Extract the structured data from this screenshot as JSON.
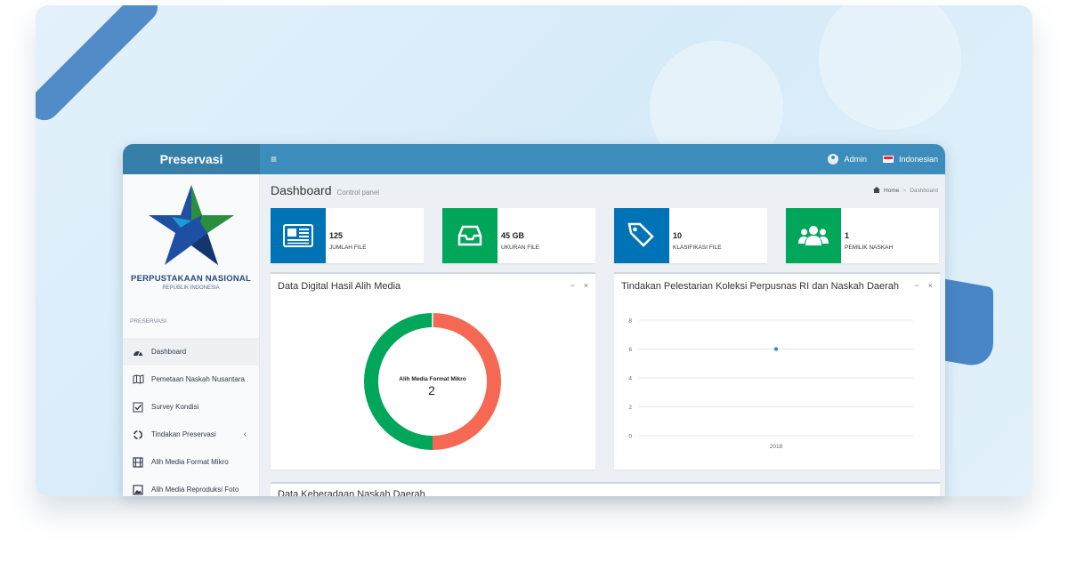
{
  "app": {
    "brand": "Preservasi",
    "menu_toggle": "≡",
    "user": "Admin",
    "language": "Indonesian"
  },
  "logo": {
    "title": "PERPUSTAKAAN NASIONAL",
    "subtitle": "REPUBLIK INDONESIA"
  },
  "sidebar": {
    "section": "PRESERVASI",
    "items": [
      {
        "label": "Dashboard",
        "icon": "dashboard-gauge-icon"
      },
      {
        "label": "Pemetaan Naskah Nusantara",
        "icon": "map-icon"
      },
      {
        "label": "Survey Kondisi",
        "icon": "checkbox-icon"
      },
      {
        "label": "Tindakan Preservasi",
        "icon": "recycle-icon"
      },
      {
        "label": "Alih Media Format Mikro",
        "icon": "film-icon"
      },
      {
        "label": "Alih Media Reproduksi Foto",
        "icon": "image-icon"
      }
    ]
  },
  "header": {
    "title": "Dashboard",
    "subtitle": "Control panel"
  },
  "breadcrumb": {
    "home": "Home",
    "separator": ">",
    "current": "Dashboard"
  },
  "stats": [
    {
      "value": "125",
      "label": "JUMLAH FILE",
      "color": "#0073b7",
      "icon": "newspaper-icon"
    },
    {
      "value": "45 GB",
      "label": "UKURAN FILE",
      "color": "#00a65a",
      "icon": "inbox-icon"
    },
    {
      "value": "10",
      "label": "KLASIFIKASI FILE",
      "color": "#0073b7",
      "icon": "tags-icon"
    },
    {
      "value": "1",
      "label": "PEMILIK NASKAH",
      "color": "#00a65a",
      "icon": "users-icon"
    }
  ],
  "panels": {
    "donut": {
      "title": "Data Digital Hasil Alih Media",
      "minimize": "−",
      "close": "×"
    },
    "line": {
      "title": "Tindakan Pelestarian Koleksi Perpusnas RI dan Naskah Daerah",
      "minimize": "−",
      "close": "×"
    },
    "bottom": {
      "title": "Data Keberadaan Naskah Daerah"
    }
  },
  "chart_data": [
    {
      "type": "pie",
      "center_label": "Alih Media Format Mikro",
      "center_value": "2",
      "slices": [
        {
          "label": "Alih Media Format Mikro",
          "value": 2,
          "color": "#00a65a"
        },
        {
          "label": "",
          "value": 2,
          "color": "#f56954"
        }
      ]
    },
    {
      "type": "line",
      "x": [
        "2018"
      ],
      "series": [
        {
          "values": [
            6
          ],
          "color": "#3c8dbc"
        }
      ],
      "yticks": [
        "8",
        "6",
        "4",
        "2",
        "0"
      ],
      "ylim": [
        0,
        8
      ],
      "grid": true
    }
  ]
}
